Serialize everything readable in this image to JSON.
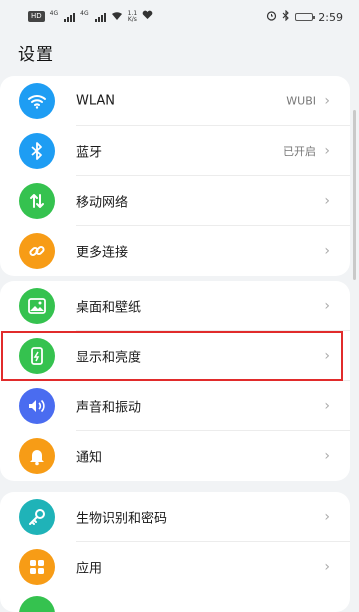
{
  "status_bar": {
    "left_chip": "HD",
    "sig1_tag": "4G",
    "sig2_tag": "4G",
    "net_speed_value": "1.1",
    "net_speed_unit": "K/s",
    "time": "2:59"
  },
  "page": {
    "title": "设置"
  },
  "groups": [
    {
      "items": [
        {
          "label": "WLAN",
          "value": "WUBI",
          "icon": "wifi-icon",
          "color": "#1e9df3"
        },
        {
          "label": "蓝牙",
          "value": "已开启",
          "icon": "bluetooth-icon",
          "color": "#1e9df3"
        },
        {
          "label": "移动网络",
          "value": "",
          "icon": "mobile-network-icon",
          "color": "#35c24f"
        },
        {
          "label": "更多连接",
          "value": "",
          "icon": "link-icon",
          "color": "#f79c16"
        }
      ]
    },
    {
      "items": [
        {
          "label": "桌面和壁纸",
          "value": "",
          "icon": "wallpaper-icon",
          "color": "#35c24f"
        },
        {
          "label": "显示和亮度",
          "value": "",
          "icon": "display-icon",
          "color": "#35c24f"
        },
        {
          "label": "声音和振动",
          "value": "",
          "icon": "sound-icon",
          "color": "#4a6cf0"
        },
        {
          "label": "通知",
          "value": "",
          "icon": "bell-icon",
          "color": "#f79c16"
        }
      ]
    },
    {
      "items": [
        {
          "label": "生物识别和密码",
          "value": "",
          "icon": "key-icon",
          "color": "#1fb3b8"
        },
        {
          "label": "应用",
          "value": "",
          "icon": "apps-icon",
          "color": "#f79c16"
        }
      ]
    }
  ]
}
